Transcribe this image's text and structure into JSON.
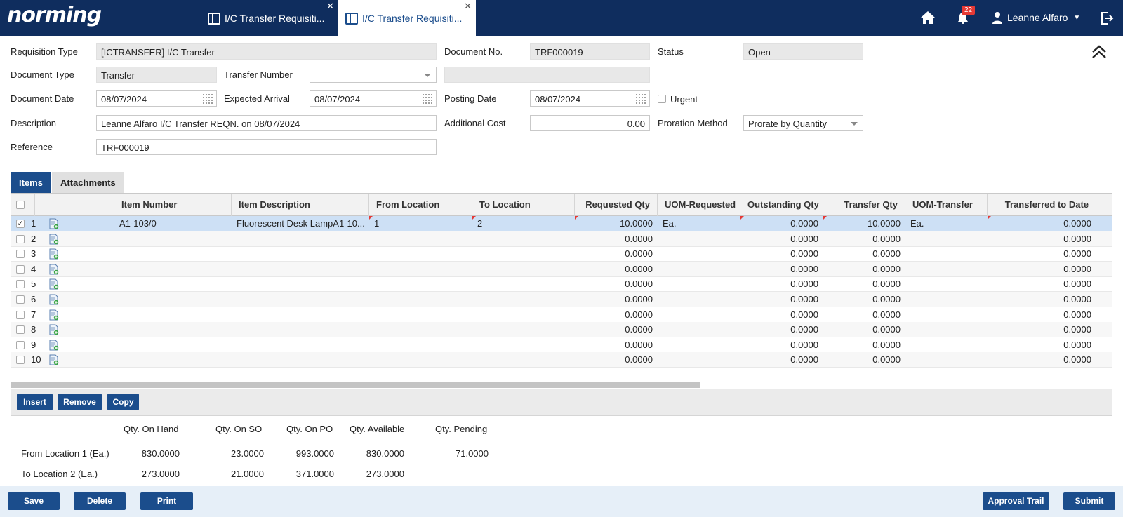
{
  "app": {
    "logo": "norming",
    "tabs": [
      {
        "label": "I/C Transfer Requisiti...",
        "close": "✕"
      },
      {
        "label": "I/C Transfer Requisiti...",
        "close": "✕"
      }
    ],
    "notification_count": "22",
    "user_name": "Leanne Alfaro"
  },
  "form": {
    "requisition_type_label": "Requisition Type",
    "requisition_type": "[ICTRANSFER] I/C Transfer",
    "document_no_label": "Document No.",
    "document_no": "TRF000019",
    "status_label": "Status",
    "status": "Open",
    "document_type_label": "Document Type",
    "document_type": "Transfer",
    "transfer_number_label": "Transfer Number",
    "transfer_number": "",
    "transfer_number_desc": "",
    "document_date_label": "Document Date",
    "document_date": "08/07/2024",
    "expected_arrival_label": "Expected Arrival",
    "expected_arrival": "08/07/2024",
    "posting_date_label": "Posting Date",
    "posting_date": "08/07/2024",
    "urgent_label": "Urgent",
    "description_label": "Description",
    "description": "Leanne Alfaro I/C Transfer REQN. on 08/07/2024",
    "additional_cost_label": "Additional Cost",
    "additional_cost": "0.00",
    "proration_method_label": "Proration Method",
    "proration_method": "Prorate by Quantity",
    "reference_label": "Reference",
    "reference": "TRF000019"
  },
  "subtabs": {
    "items": "Items",
    "attachments": "Attachments"
  },
  "grid": {
    "headers": {
      "item_number": "Item Number",
      "item_description": "Item Description",
      "from_location": "From Location",
      "to_location": "To Location",
      "requested_qty": "Requested Qty",
      "uom_requested": "UOM-Requested",
      "outstanding_qty": "Outstanding Qty",
      "transfer_qty": "Transfer Qty",
      "uom_transfer": "UOM-Transfer",
      "transferred_to_date": "Transferred to Date"
    },
    "rows": [
      {
        "num": "1",
        "checked": "✓",
        "item_number": "A1-103/0",
        "item_description": "Fluorescent Desk LampA1-10...",
        "from_location": "1",
        "to_location": "2",
        "requested_qty": "10.0000",
        "uom_requested": "Ea.",
        "outstanding_qty": "0.0000",
        "transfer_qty": "10.0000",
        "uom_transfer": "Ea.",
        "transferred_to_date": "0.0000"
      },
      {
        "num": "2",
        "checked": "",
        "item_number": "",
        "item_description": "",
        "from_location": "",
        "to_location": "",
        "requested_qty": "0.0000",
        "uom_requested": "",
        "outstanding_qty": "0.0000",
        "transfer_qty": "0.0000",
        "uom_transfer": "",
        "transferred_to_date": "0.0000"
      },
      {
        "num": "3",
        "checked": "",
        "item_number": "",
        "item_description": "",
        "from_location": "",
        "to_location": "",
        "requested_qty": "0.0000",
        "uom_requested": "",
        "outstanding_qty": "0.0000",
        "transfer_qty": "0.0000",
        "uom_transfer": "",
        "transferred_to_date": "0.0000"
      },
      {
        "num": "4",
        "checked": "",
        "item_number": "",
        "item_description": "",
        "from_location": "",
        "to_location": "",
        "requested_qty": "0.0000",
        "uom_requested": "",
        "outstanding_qty": "0.0000",
        "transfer_qty": "0.0000",
        "uom_transfer": "",
        "transferred_to_date": "0.0000"
      },
      {
        "num": "5",
        "checked": "",
        "item_number": "",
        "item_description": "",
        "from_location": "",
        "to_location": "",
        "requested_qty": "0.0000",
        "uom_requested": "",
        "outstanding_qty": "0.0000",
        "transfer_qty": "0.0000",
        "uom_transfer": "",
        "transferred_to_date": "0.0000"
      },
      {
        "num": "6",
        "checked": "",
        "item_number": "",
        "item_description": "",
        "from_location": "",
        "to_location": "",
        "requested_qty": "0.0000",
        "uom_requested": "",
        "outstanding_qty": "0.0000",
        "transfer_qty": "0.0000",
        "uom_transfer": "",
        "transferred_to_date": "0.0000"
      },
      {
        "num": "7",
        "checked": "",
        "item_number": "",
        "item_description": "",
        "from_location": "",
        "to_location": "",
        "requested_qty": "0.0000",
        "uom_requested": "",
        "outstanding_qty": "0.0000",
        "transfer_qty": "0.0000",
        "uom_transfer": "",
        "transferred_to_date": "0.0000"
      },
      {
        "num": "8",
        "checked": "",
        "item_number": "",
        "item_description": "",
        "from_location": "",
        "to_location": "",
        "requested_qty": "0.0000",
        "uom_requested": "",
        "outstanding_qty": "0.0000",
        "transfer_qty": "0.0000",
        "uom_transfer": "",
        "transferred_to_date": "0.0000"
      },
      {
        "num": "9",
        "checked": "",
        "item_number": "",
        "item_description": "",
        "from_location": "",
        "to_location": "",
        "requested_qty": "0.0000",
        "uom_requested": "",
        "outstanding_qty": "0.0000",
        "transfer_qty": "0.0000",
        "uom_transfer": "",
        "transferred_to_date": "0.0000"
      },
      {
        "num": "10",
        "checked": "",
        "item_number": "",
        "item_description": "",
        "from_location": "",
        "to_location": "",
        "requested_qty": "0.0000",
        "uom_requested": "",
        "outstanding_qty": "0.0000",
        "transfer_qty": "0.0000",
        "uom_transfer": "",
        "transferred_to_date": "0.0000"
      }
    ],
    "buttons": {
      "insert": "Insert",
      "remove": "Remove",
      "copy": "Copy"
    }
  },
  "qty_summary": {
    "headers": {
      "on_hand": "Qty. On Hand",
      "on_so": "Qty. On SO",
      "on_po": "Qty. On PO",
      "available": "Qty. Available",
      "pending": "Qty. Pending"
    },
    "rows": [
      {
        "label": "From Location 1 (Ea.)",
        "on_hand": "830.0000",
        "on_so": "23.0000",
        "on_po": "993.0000",
        "available": "830.0000",
        "pending": "71.0000"
      },
      {
        "label": "To Location 2 (Ea.)",
        "on_hand": "273.0000",
        "on_so": "21.0000",
        "on_po": "371.0000",
        "available": "273.0000",
        "pending": ""
      }
    ]
  },
  "footer": {
    "save": "Save",
    "delete": "Delete",
    "print": "Print",
    "approval_trail": "Approval Trail",
    "submit": "Submit"
  },
  "colors": {
    "nav_bg": "#0f2d5e",
    "primary": "#1b4d8c",
    "selected_row": "#cde0f5",
    "badge": "#e53935"
  }
}
